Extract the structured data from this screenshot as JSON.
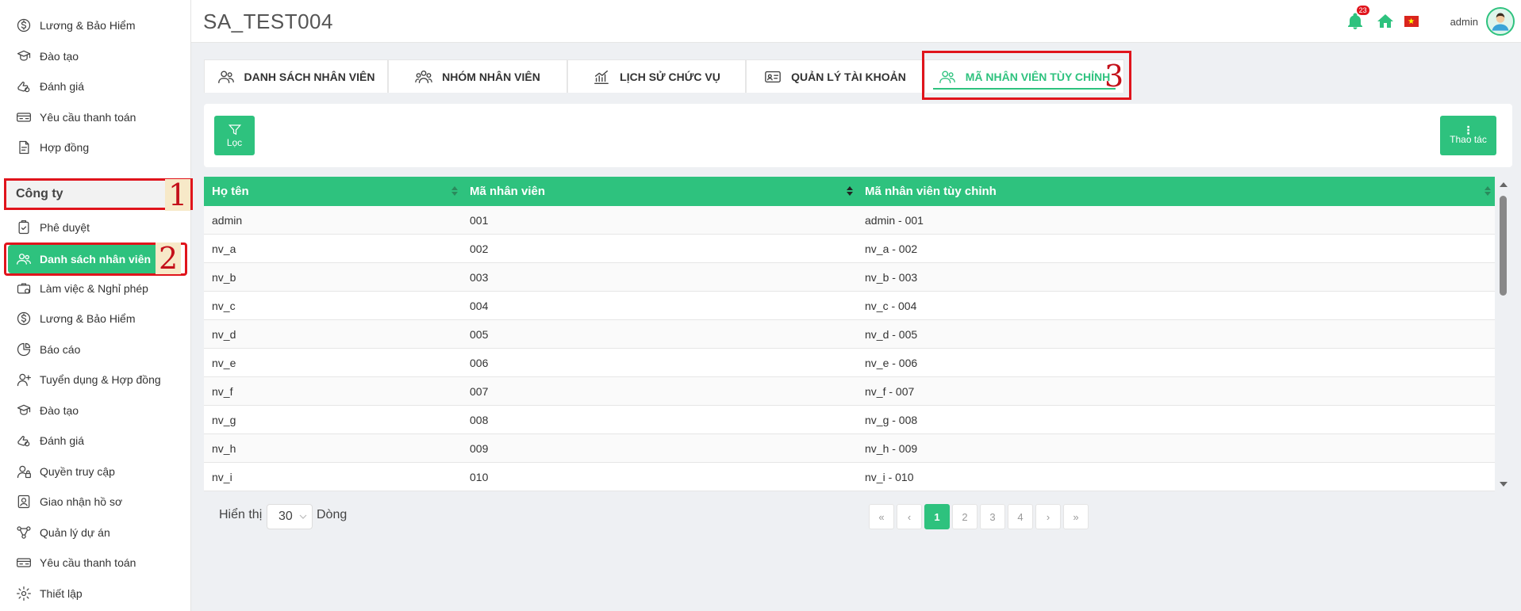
{
  "header": {
    "title": "SA_TEST004",
    "notification_count": "23",
    "user_name": "admin"
  },
  "sidebar": {
    "top_items": [
      {
        "label": "Lương & Bảo Hiểm",
        "icon": "dollar-circle-icon"
      },
      {
        "label": "Đào tạo",
        "icon": "training-icon"
      },
      {
        "label": "Đánh giá",
        "icon": "review-icon"
      },
      {
        "label": "Yêu cầu thanh toán",
        "icon": "payment-request-icon"
      },
      {
        "label": "Hợp đồng",
        "icon": "contract-icon"
      }
    ],
    "section_label": "Công ty",
    "active_item": "Danh sách nhân viên",
    "items": [
      {
        "label": "Phê duyệt",
        "icon": "approval-icon"
      },
      {
        "label": "Làm việc & Nghỉ phép",
        "icon": "work-leave-icon"
      },
      {
        "label": "Lương & Bảo Hiểm",
        "icon": "dollar-circle-icon"
      },
      {
        "label": "Báo cáo",
        "icon": "report-icon"
      },
      {
        "label": "Tuyển dụng & Hợp đồng",
        "icon": "recruit-icon"
      },
      {
        "label": "Đào tạo",
        "icon": "training-icon"
      },
      {
        "label": "Đánh giá",
        "icon": "review-icon"
      },
      {
        "label": "Quyền truy cập",
        "icon": "access-icon"
      },
      {
        "label": "Giao nhận hồ sơ",
        "icon": "documents-icon"
      },
      {
        "label": "Quản lý dự án",
        "icon": "project-icon"
      },
      {
        "label": "Yêu cầu thanh toán",
        "icon": "payment-request-icon"
      },
      {
        "label": "Thiết lập",
        "icon": "gear-icon"
      }
    ]
  },
  "annotations": {
    "n1": "1",
    "n2": "2",
    "n3": "3"
  },
  "tabs": [
    {
      "label": "DANH SÁCH NHÂN VIÊN",
      "icon": "users-icon"
    },
    {
      "label": "NHÓM NHÂN VIÊN",
      "icon": "group-icon"
    },
    {
      "label": "LỊCH SỬ CHỨC VỤ",
      "icon": "chart-history-icon"
    },
    {
      "label": "QUẢN LÝ TÀI KHOẢN",
      "icon": "id-card-icon"
    },
    {
      "label": "MÃ NHÂN VIÊN TÙY CHỈNH",
      "icon": "users-icon"
    }
  ],
  "toolbar": {
    "filter_label": "Lọc",
    "actions_label": "Thao tác"
  },
  "table": {
    "columns": [
      "Họ tên",
      "Mã nhân viên",
      "Mã nhân viên tùy chỉnh"
    ],
    "rows": [
      [
        "admin",
        "001",
        "admin - 001"
      ],
      [
        "nv_a",
        "002",
        "nv_a - 002"
      ],
      [
        "nv_b",
        "003",
        "nv_b - 003"
      ],
      [
        "nv_c",
        "004",
        "nv_c - 004"
      ],
      [
        "nv_d",
        "005",
        "nv_d - 005"
      ],
      [
        "nv_e",
        "006",
        "nv_e - 006"
      ],
      [
        "nv_f",
        "007",
        "nv_f - 007"
      ],
      [
        "nv_g",
        "008",
        "nv_g - 008"
      ],
      [
        "nv_h",
        "009",
        "nv_h - 009"
      ],
      [
        "nv_i",
        "010",
        "nv_i - 010"
      ]
    ]
  },
  "footer": {
    "show_label": "Hiển thị",
    "rows_per_page": "30",
    "rows_label": "Dòng",
    "pages": [
      "«",
      "‹",
      "1",
      "2",
      "3",
      "4",
      "›",
      "»"
    ],
    "current_page": "1"
  },
  "colors": {
    "accent": "#2ec27e",
    "highlight": "#e0141c"
  }
}
